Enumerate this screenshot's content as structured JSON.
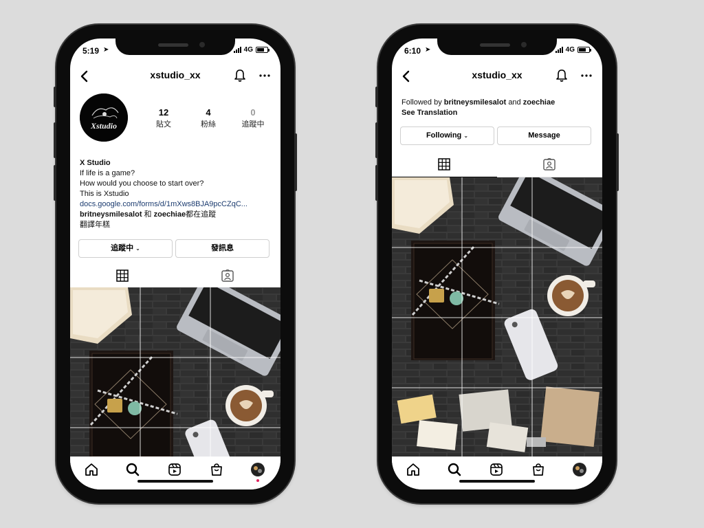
{
  "left_phone": {
    "status": {
      "time": "5:19",
      "network": "4G"
    },
    "header": {
      "username": "xstudio_xx"
    },
    "stats": [
      {
        "value": "12",
        "label": "貼文"
      },
      {
        "value": "4",
        "label": "粉絲"
      },
      {
        "value": "0",
        "label": "追蹤中"
      }
    ],
    "avatar_text": "Xstudio",
    "bio": {
      "name": "X Studio",
      "line1": "If life is a game?",
      "line2": "How would you choose to start over?",
      "line3": "This is Xstudio",
      "link": "docs.google.com/forms/d/1mXws8BJA9pcCZqC...",
      "followed_user1": "britneysmilesalot",
      "followed_and": "和",
      "followed_user2": "zoechiae",
      "followed_suffix": "都在追蹤",
      "translate": "翻譯年糕"
    },
    "buttons": {
      "following": "追蹤中",
      "message": "發訊息"
    }
  },
  "right_phone": {
    "status": {
      "time": "6:10",
      "network": "4G"
    },
    "header": {
      "username": "xstudio_xx"
    },
    "followed_prefix": "Followed by",
    "followed_user1": "britneysmilesalot",
    "followed_and": "and",
    "followed_user2": "zoechiae",
    "see_translation": "See Translation",
    "buttons": {
      "following": "Following",
      "message": "Message"
    }
  },
  "icons": [
    "back-icon",
    "bell-icon",
    "more-icon",
    "grid-icon",
    "tagged-icon",
    "home-icon",
    "search-icon",
    "reels-icon",
    "shop-icon",
    "profile-avatar-icon"
  ]
}
